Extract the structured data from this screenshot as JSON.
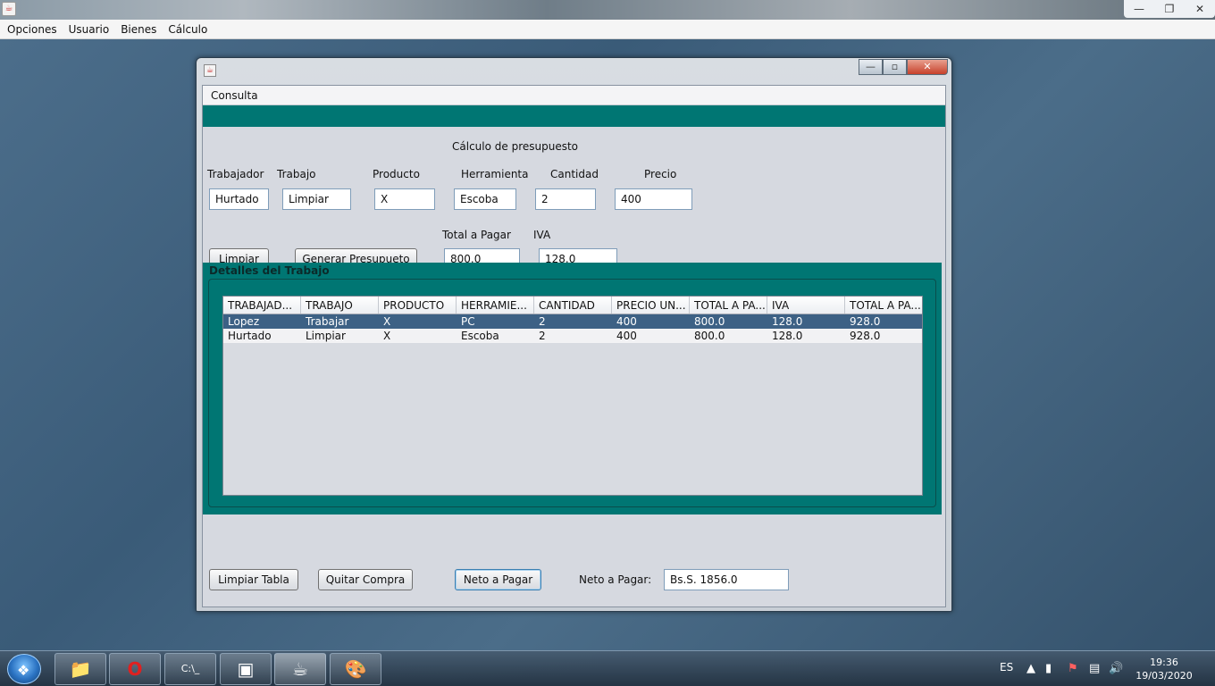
{
  "app": {
    "menu": [
      "Opciones",
      "Usuario",
      "Bienes",
      "Cálculo"
    ],
    "window_controls": [
      "—",
      "❐",
      "✕"
    ]
  },
  "frame": {
    "menu": "Consulta",
    "heading": "Cálculo de presupuesto",
    "labels": {
      "trabajador": "Trabajador",
      "trabajo": "Trabajo",
      "producto": "Producto",
      "herramienta": "Herramienta",
      "cantidad": "Cantidad",
      "precio": "Precio",
      "total_a_pagar": "Total a Pagar",
      "iva": "IVA",
      "neto_a_pagar": "Neto a Pagar:"
    },
    "fields": {
      "trabajador": "Hurtado",
      "trabajo": "Limpiar",
      "producto": "X",
      "herramienta": "Escoba",
      "cantidad": "2",
      "precio": "400",
      "total_a_pagar": "800.0",
      "iva": "128.0",
      "neto_a_pagar": "Bs.S. 1856.0"
    },
    "buttons": {
      "limpiar": "Limpiar",
      "generar": "Generar Presupueto",
      "limpiar_tabla": "Limpiar Tabla",
      "quitar_compra": "Quitar Compra",
      "neto_a_pagar": "Neto a Pagar"
    },
    "details_title": "Detalles del Trabajo",
    "table": {
      "columns": [
        "TRABAJAD...",
        "TRABAJO",
        "PRODUCTO",
        "HERRAMIE...",
        "CANTIDAD",
        "PRECIO UN...",
        "TOTAL A PA...",
        "IVA",
        "TOTAL A PA..."
      ],
      "rows": [
        [
          "Lopez",
          "Trabajar",
          "X",
          "PC",
          "2",
          "400",
          "800.0",
          "128.0",
          "928.0"
        ],
        [
          "Hurtado",
          "Limpiar",
          "X",
          "Escoba",
          "2",
          "400",
          "800.0",
          "128.0",
          "928.0"
        ]
      ]
    }
  },
  "taskbar": {
    "language": "ES",
    "time": "19:36",
    "date": "19/03/2020"
  },
  "colors": {
    "teal": "#007673",
    "selection": "#3d6185"
  }
}
